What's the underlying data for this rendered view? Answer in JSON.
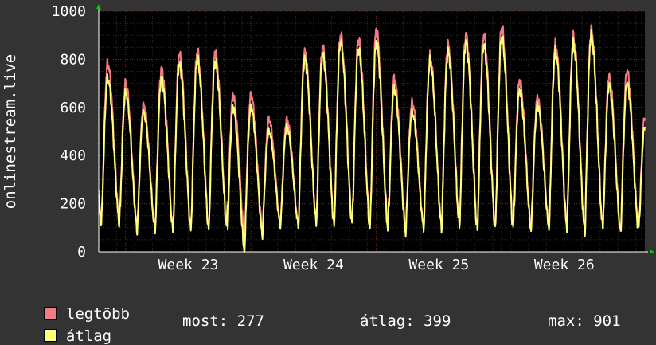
{
  "colors": {
    "background": "#333333",
    "plot_background": "#000000",
    "grid_minor": "#2c2c2c",
    "grid_major": "#7a2a2a",
    "max_series": "#f47a86",
    "avg_series": "#ffff7a",
    "axis_arrow": "#00cc00"
  },
  "legend": {
    "max_label": "legtöbb",
    "avg_label": "átlag",
    "now_text": "most: 277",
    "avg_text": "átlag: 399",
    "max_text": "max: 901"
  },
  "chart_data": {
    "type": "line",
    "title": "",
    "ylabel": "onlinestream.live",
    "xlabel": "",
    "ylim": [
      0,
      1000
    ],
    "yticks": [
      0,
      200,
      400,
      600,
      800,
      1000
    ],
    "xtick_labels": [
      "Week 23",
      "Week 24",
      "Week 25",
      "Week 26"
    ],
    "x_days": 30.5,
    "grid": true,
    "legend_position": "bottom-left",
    "series": [
      {
        "name": "legtöbb",
        "color": "#f47a86",
        "daily_peaks": [
          780,
          700,
          610,
          760,
          820,
          830,
          830,
          650,
          650,
          550,
          550,
          830,
          850,
          900,
          880,
          920,
          720,
          620,
          810,
          860,
          900,
          900,
          930,
          710,
          640,
          860,
          890,
          920,
          730,
          750,
          560,
          440
        ],
        "daily_troughs": [
          130,
          100,
          100,
          100,
          100,
          100,
          120,
          60,
          90,
          120,
          120,
          130,
          120,
          130,
          110,
          110,
          90,
          110,
          110,
          120,
          100,
          110,
          110,
          100,
          110,
          110,
          90,
          110,
          90,
          100,
          80,
          280
        ]
      },
      {
        "name": "átlag",
        "color": "#ffff7a",
        "daily_peaks": [
          720,
          660,
          580,
          720,
          780,
          800,
          790,
          600,
          600,
          500,
          520,
          800,
          820,
          870,
          840,
          870,
          680,
          580,
          790,
          830,
          870,
          860,
          890,
          670,
          610,
          830,
          860,
          900,
          690,
          700,
          520,
          380
        ],
        "daily_troughs": [
          120,
          90,
          90,
          90,
          90,
          90,
          110,
          0,
          70,
          110,
          110,
          120,
          110,
          120,
          100,
          100,
          80,
          100,
          100,
          110,
          90,
          100,
          100,
          90,
          100,
          100,
          80,
          100,
          80,
          90,
          70,
          270
        ]
      }
    ]
  }
}
